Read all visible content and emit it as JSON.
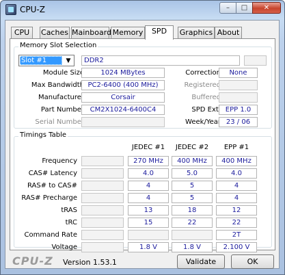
{
  "window": {
    "title": "CPU-Z",
    "min_glyph": "–",
    "max_glyph": "□",
    "close_glyph": "✕"
  },
  "tabs": [
    "CPU",
    "Caches",
    "Mainboard",
    "Memory",
    "SPD",
    "Graphics",
    "About"
  ],
  "active_tab": "SPD",
  "slot_selection": {
    "title": "Memory Slot Selection",
    "selected": "Slot #1",
    "module_type": "DDR2",
    "fields": {
      "module_size": {
        "label": "Module Size",
        "value": "1024 MBytes"
      },
      "max_bandwidth": {
        "label": "Max Bandwidth",
        "value": "PC2-6400 (400 MHz)"
      },
      "manufacturer": {
        "label": "Manufacturer",
        "value": "Corsair"
      },
      "part_number": {
        "label": "Part Number",
        "value": "CM2X1024-6400C4"
      },
      "serial_number": {
        "label": "Serial Number",
        "value": ""
      },
      "correction": {
        "label": "Correction",
        "value": "None"
      },
      "registered": {
        "label": "Registered",
        "value": ""
      },
      "buffered": {
        "label": "Buffered",
        "value": ""
      },
      "spd_ext": {
        "label": "SPD Ext.",
        "value": "EPP 1.0"
      },
      "week_year": {
        "label": "Week/Year",
        "value": "23 / 06"
      }
    }
  },
  "timings": {
    "title": "Timings Table",
    "columns": [
      "JEDEC #1",
      "JEDEC #2",
      "EPP #1"
    ],
    "rows": [
      {
        "label": "Frequency",
        "values": [
          "",
          "270 MHz",
          "400 MHz",
          "400 MHz"
        ]
      },
      {
        "label": "CAS# Latency",
        "values": [
          "",
          "4.0",
          "5.0",
          "4.0"
        ]
      },
      {
        "label": "RAS# to CAS#",
        "values": [
          "",
          "4",
          "5",
          "4"
        ]
      },
      {
        "label": "RAS# Precharge",
        "values": [
          "",
          "4",
          "5",
          "4"
        ]
      },
      {
        "label": "tRAS",
        "values": [
          "",
          "13",
          "18",
          "12"
        ]
      },
      {
        "label": "tRC",
        "values": [
          "",
          "15",
          "22",
          "22"
        ]
      },
      {
        "label": "Command Rate",
        "values": [
          "",
          "",
          "",
          "2T"
        ]
      },
      {
        "label": "Voltage",
        "values": [
          "",
          "1.8 V",
          "1.8 V",
          "2.100 V"
        ]
      }
    ]
  },
  "footer": {
    "logo": "CPU-Z",
    "version": "Version 1.53.1",
    "validate_label": "Validate",
    "ok_label": "OK"
  }
}
